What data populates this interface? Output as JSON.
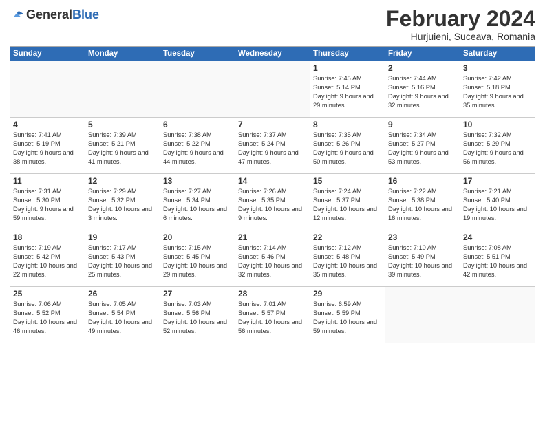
{
  "header": {
    "logo_general": "General",
    "logo_blue": "Blue",
    "month_title": "February 2024",
    "location": "Hurjuieni, Suceava, Romania"
  },
  "weekdays": [
    "Sunday",
    "Monday",
    "Tuesday",
    "Wednesday",
    "Thursday",
    "Friday",
    "Saturday"
  ],
  "weeks": [
    [
      {
        "day": "",
        "sunrise": "",
        "sunset": "",
        "daylight": "",
        "empty": true
      },
      {
        "day": "",
        "sunrise": "",
        "sunset": "",
        "daylight": "",
        "empty": true
      },
      {
        "day": "",
        "sunrise": "",
        "sunset": "",
        "daylight": "",
        "empty": true
      },
      {
        "day": "",
        "sunrise": "",
        "sunset": "",
        "daylight": "",
        "empty": true
      },
      {
        "day": "1",
        "sunrise": "Sunrise: 7:45 AM",
        "sunset": "Sunset: 5:14 PM",
        "daylight": "Daylight: 9 hours and 29 minutes.",
        "empty": false
      },
      {
        "day": "2",
        "sunrise": "Sunrise: 7:44 AM",
        "sunset": "Sunset: 5:16 PM",
        "daylight": "Daylight: 9 hours and 32 minutes.",
        "empty": false
      },
      {
        "day": "3",
        "sunrise": "Sunrise: 7:42 AM",
        "sunset": "Sunset: 5:18 PM",
        "daylight": "Daylight: 9 hours and 35 minutes.",
        "empty": false
      }
    ],
    [
      {
        "day": "4",
        "sunrise": "Sunrise: 7:41 AM",
        "sunset": "Sunset: 5:19 PM",
        "daylight": "Daylight: 9 hours and 38 minutes.",
        "empty": false
      },
      {
        "day": "5",
        "sunrise": "Sunrise: 7:39 AM",
        "sunset": "Sunset: 5:21 PM",
        "daylight": "Daylight: 9 hours and 41 minutes.",
        "empty": false
      },
      {
        "day": "6",
        "sunrise": "Sunrise: 7:38 AM",
        "sunset": "Sunset: 5:22 PM",
        "daylight": "Daylight: 9 hours and 44 minutes.",
        "empty": false
      },
      {
        "day": "7",
        "sunrise": "Sunrise: 7:37 AM",
        "sunset": "Sunset: 5:24 PM",
        "daylight": "Daylight: 9 hours and 47 minutes.",
        "empty": false
      },
      {
        "day": "8",
        "sunrise": "Sunrise: 7:35 AM",
        "sunset": "Sunset: 5:26 PM",
        "daylight": "Daylight: 9 hours and 50 minutes.",
        "empty": false
      },
      {
        "day": "9",
        "sunrise": "Sunrise: 7:34 AM",
        "sunset": "Sunset: 5:27 PM",
        "daylight": "Daylight: 9 hours and 53 minutes.",
        "empty": false
      },
      {
        "day": "10",
        "sunrise": "Sunrise: 7:32 AM",
        "sunset": "Sunset: 5:29 PM",
        "daylight": "Daylight: 9 hours and 56 minutes.",
        "empty": false
      }
    ],
    [
      {
        "day": "11",
        "sunrise": "Sunrise: 7:31 AM",
        "sunset": "Sunset: 5:30 PM",
        "daylight": "Daylight: 9 hours and 59 minutes.",
        "empty": false
      },
      {
        "day": "12",
        "sunrise": "Sunrise: 7:29 AM",
        "sunset": "Sunset: 5:32 PM",
        "daylight": "Daylight: 10 hours and 3 minutes.",
        "empty": false
      },
      {
        "day": "13",
        "sunrise": "Sunrise: 7:27 AM",
        "sunset": "Sunset: 5:34 PM",
        "daylight": "Daylight: 10 hours and 6 minutes.",
        "empty": false
      },
      {
        "day": "14",
        "sunrise": "Sunrise: 7:26 AM",
        "sunset": "Sunset: 5:35 PM",
        "daylight": "Daylight: 10 hours and 9 minutes.",
        "empty": false
      },
      {
        "day": "15",
        "sunrise": "Sunrise: 7:24 AM",
        "sunset": "Sunset: 5:37 PM",
        "daylight": "Daylight: 10 hours and 12 minutes.",
        "empty": false
      },
      {
        "day": "16",
        "sunrise": "Sunrise: 7:22 AM",
        "sunset": "Sunset: 5:38 PM",
        "daylight": "Daylight: 10 hours and 16 minutes.",
        "empty": false
      },
      {
        "day": "17",
        "sunrise": "Sunrise: 7:21 AM",
        "sunset": "Sunset: 5:40 PM",
        "daylight": "Daylight: 10 hours and 19 minutes.",
        "empty": false
      }
    ],
    [
      {
        "day": "18",
        "sunrise": "Sunrise: 7:19 AM",
        "sunset": "Sunset: 5:42 PM",
        "daylight": "Daylight: 10 hours and 22 minutes.",
        "empty": false
      },
      {
        "day": "19",
        "sunrise": "Sunrise: 7:17 AM",
        "sunset": "Sunset: 5:43 PM",
        "daylight": "Daylight: 10 hours and 25 minutes.",
        "empty": false
      },
      {
        "day": "20",
        "sunrise": "Sunrise: 7:15 AM",
        "sunset": "Sunset: 5:45 PM",
        "daylight": "Daylight: 10 hours and 29 minutes.",
        "empty": false
      },
      {
        "day": "21",
        "sunrise": "Sunrise: 7:14 AM",
        "sunset": "Sunset: 5:46 PM",
        "daylight": "Daylight: 10 hours and 32 minutes.",
        "empty": false
      },
      {
        "day": "22",
        "sunrise": "Sunrise: 7:12 AM",
        "sunset": "Sunset: 5:48 PM",
        "daylight": "Daylight: 10 hours and 35 minutes.",
        "empty": false
      },
      {
        "day": "23",
        "sunrise": "Sunrise: 7:10 AM",
        "sunset": "Sunset: 5:49 PM",
        "daylight": "Daylight: 10 hours and 39 minutes.",
        "empty": false
      },
      {
        "day": "24",
        "sunrise": "Sunrise: 7:08 AM",
        "sunset": "Sunset: 5:51 PM",
        "daylight": "Daylight: 10 hours and 42 minutes.",
        "empty": false
      }
    ],
    [
      {
        "day": "25",
        "sunrise": "Sunrise: 7:06 AM",
        "sunset": "Sunset: 5:52 PM",
        "daylight": "Daylight: 10 hours and 46 minutes.",
        "empty": false
      },
      {
        "day": "26",
        "sunrise": "Sunrise: 7:05 AM",
        "sunset": "Sunset: 5:54 PM",
        "daylight": "Daylight: 10 hours and 49 minutes.",
        "empty": false
      },
      {
        "day": "27",
        "sunrise": "Sunrise: 7:03 AM",
        "sunset": "Sunset: 5:56 PM",
        "daylight": "Daylight: 10 hours and 52 minutes.",
        "empty": false
      },
      {
        "day": "28",
        "sunrise": "Sunrise: 7:01 AM",
        "sunset": "Sunset: 5:57 PM",
        "daylight": "Daylight: 10 hours and 56 minutes.",
        "empty": false
      },
      {
        "day": "29",
        "sunrise": "Sunrise: 6:59 AM",
        "sunset": "Sunset: 5:59 PM",
        "daylight": "Daylight: 10 hours and 59 minutes.",
        "empty": false
      },
      {
        "day": "",
        "sunrise": "",
        "sunset": "",
        "daylight": "",
        "empty": true
      },
      {
        "day": "",
        "sunrise": "",
        "sunset": "",
        "daylight": "",
        "empty": true
      }
    ]
  ]
}
